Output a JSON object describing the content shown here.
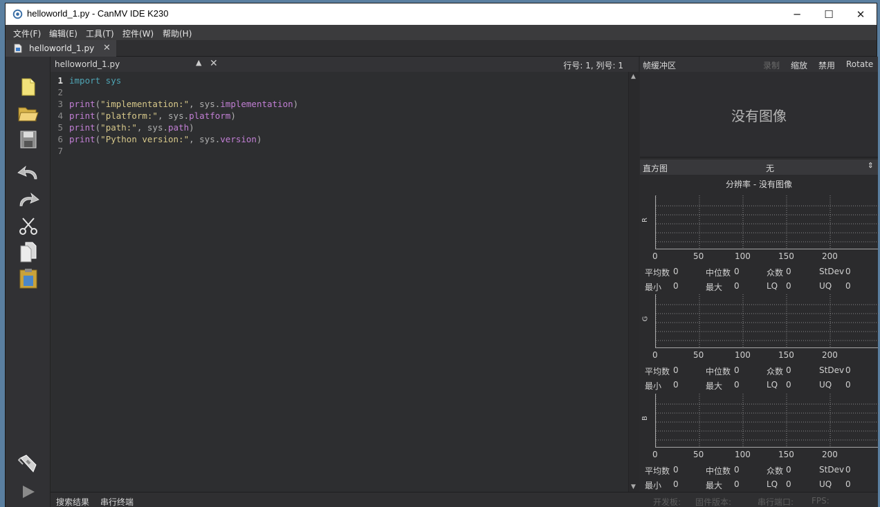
{
  "window": {
    "title": "helloworld_1.py - CanMV IDE K230",
    "minimize": "─",
    "maximize": "☐",
    "close": "✕"
  },
  "menu": [
    "文件(F)",
    "编辑(E)",
    "工具(T)",
    "控件(W)",
    "帮助(H)"
  ],
  "file_tab": {
    "name": "helloworld_1.py",
    "close": "✕"
  },
  "editor": {
    "file_name": "helloworld_1.py",
    "cursor_position": "行号: 1, 列号: 1",
    "line_numbers": [
      "1",
      "2",
      "3",
      "4",
      "5",
      "6",
      "7"
    ],
    "code": {
      "l1_kw": "import",
      "l1_mod": " sys",
      "l3_fn": "print",
      "l3_open": "(",
      "l3_str": "\"implementation:\"",
      "l3_mid": ", sys.",
      "l3_attr": "implementation",
      "l3_close": ")",
      "l4_fn": "print",
      "l4_open": "(",
      "l4_str": "\"platform:\"",
      "l4_mid": ", sys.",
      "l4_attr": "platform",
      "l4_close": ")",
      "l5_fn": "print",
      "l5_open": "(",
      "l5_str": "\"path:\"",
      "l5_mid": ", sys.",
      "l5_attr": "path",
      "l5_close": ")",
      "l6_fn": "print",
      "l6_open": "(",
      "l6_str": "\"Python version:\"",
      "l6_mid": ", sys.",
      "l6_attr": "version",
      "l6_close": ")"
    }
  },
  "frame_buffer": {
    "title": "帧缓冲区",
    "buttons": [
      "录制",
      "缩放",
      "禁用",
      "Rotate"
    ],
    "no_image": "没有图像"
  },
  "histogram": {
    "title": "直方图",
    "color_space": "无",
    "resolution": "分辨率 - 没有图像",
    "x_ticks": [
      "0",
      "50",
      "100",
      "150",
      "200"
    ],
    "channels": [
      {
        "label": "R",
        "mean": "平均数",
        "mean_v": "0",
        "median": "中位数",
        "median_v": "0",
        "mode": "众数",
        "mode_v": "0",
        "stdev": "StDev",
        "stdev_v": "0",
        "min": "最小",
        "min_v": "0",
        "max": "最大",
        "max_v": "0",
        "lq": "LQ",
        "lq_v": "0",
        "uq": "UQ",
        "uq_v": "0"
      },
      {
        "label": "G",
        "mean": "平均数",
        "mean_v": "0",
        "median": "中位数",
        "median_v": "0",
        "mode": "众数",
        "mode_v": "0",
        "stdev": "StDev",
        "stdev_v": "0",
        "min": "最小",
        "min_v": "0",
        "max": "最大",
        "max_v": "0",
        "lq": "LQ",
        "lq_v": "0",
        "uq": "UQ",
        "uq_v": "0"
      },
      {
        "label": "B",
        "mean": "平均数",
        "mean_v": "0",
        "median": "中位数",
        "median_v": "0",
        "mode": "众数",
        "mode_v": "0",
        "stdev": "StDev",
        "stdev_v": "0",
        "min": "最小",
        "min_v": "0",
        "max": "最大",
        "max_v": "0",
        "lq": "LQ",
        "lq_v": "0",
        "uq": "UQ",
        "uq_v": "0"
      }
    ]
  },
  "bottom": {
    "search_results": "搜索结果",
    "serial_terminal": "串行终端",
    "board": "开发板:",
    "firmware": "固件版本:",
    "serial_port": "串行端口:",
    "fps": "FPS:"
  },
  "toolbar_icons": [
    "new-file-icon",
    "open-folder-icon",
    "save-icon",
    "undo-icon",
    "redo-icon",
    "cut-icon",
    "copy-icon",
    "paste-icon",
    "connect-icon",
    "run-icon"
  ],
  "colors": {
    "background": "#2b2b2d",
    "keyword": "#4fa5b5",
    "function": "#c27fd5",
    "string": "#d7c88a"
  }
}
